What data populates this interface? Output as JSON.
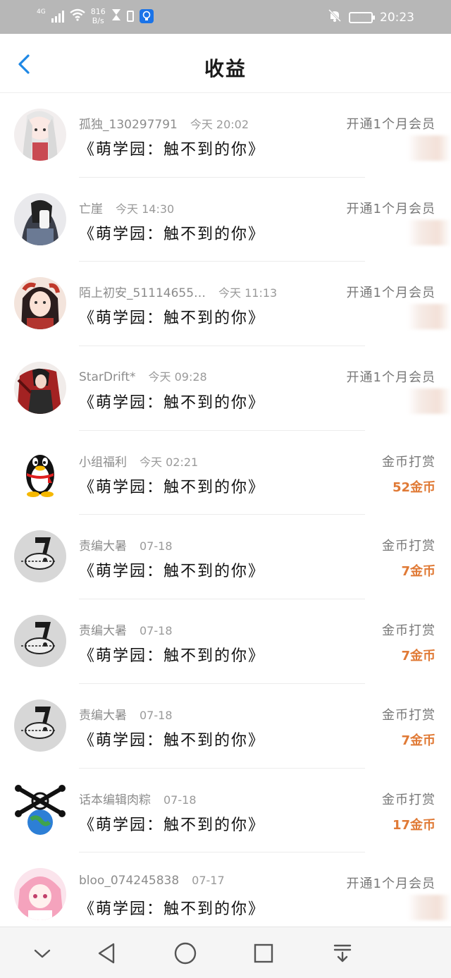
{
  "status_bar": {
    "network": "4G",
    "speed_value": "816",
    "speed_unit": "B/s",
    "battery": "90",
    "time": "20:23",
    "icons": [
      "signal-icon",
      "wifi-icon",
      "hourglass-icon",
      "battery-small-icon",
      "bulb-app-icon",
      "mute-bell-icon"
    ]
  },
  "header": {
    "title": "收益",
    "back_icon": "chevron-left-icon",
    "accent": "#1e88e5"
  },
  "income_list": [
    {
      "user": "孤独_130297791",
      "time": "今天 20:02",
      "work": "《萌学园：触不到的你》",
      "type": "开通1个月会员",
      "amount": "",
      "avatar": "anime-girl-white-hair"
    },
    {
      "user": "亡崖",
      "time": "今天 14:30",
      "work": "《萌学园：触不到的你》",
      "type": "开通1个月会员",
      "amount": "",
      "avatar": "girl-phone-selfie"
    },
    {
      "user": "陌上初安_51114655…",
      "time": "今天 11:13",
      "work": "《萌学园：触不到的你》",
      "type": "开通1个月会员",
      "amount": "",
      "avatar": "anime-girl-red"
    },
    {
      "user": "StarDrift*",
      "time": "今天 09:28",
      "work": "《萌学园：触不到的你》",
      "type": "开通1个月会员",
      "amount": "",
      "avatar": "warrior-red-cloak"
    },
    {
      "user": "小组福利",
      "time": "今天 02:21",
      "work": "《萌学园：触不到的你》",
      "type": "金币打赏",
      "amount": "52金币",
      "avatar": "qq-penguin"
    },
    {
      "user": "责编大暑",
      "time": "07-18",
      "work": "《萌学园：触不到的你》",
      "type": "金币打赏",
      "amount": "7金币",
      "avatar": "chainsaw-sketch"
    },
    {
      "user": "责编大暑",
      "time": "07-18",
      "work": "《萌学园：触不到的你》",
      "type": "金币打赏",
      "amount": "7金币",
      "avatar": "chainsaw-sketch"
    },
    {
      "user": "责编大暑",
      "time": "07-18",
      "work": "《萌学园：触不到的你》",
      "type": "金币打赏",
      "amount": "7金币",
      "avatar": "chainsaw-sketch"
    },
    {
      "user": "话本编辑肉粽",
      "time": "07-18",
      "work": "《萌学园：触不到的你》",
      "type": "金币打赏",
      "amount": "17金币",
      "avatar": "earth-crossbones"
    },
    {
      "user": "bloo_074245838",
      "time": "07-17",
      "work": "《萌学园：触不到的你》",
      "type": "开通1个月会员",
      "amount": "",
      "avatar": "anime-girl-pink"
    }
  ],
  "colors": {
    "amount": "#e07a36",
    "status_bar_bg": "#b7b7b7",
    "nav_bg": "#f5f5f5"
  },
  "nav_bar": [
    "chevron-down-icon",
    "back-triangle-icon",
    "home-circle-icon",
    "recents-square-icon",
    "notification-pull-icon"
  ]
}
